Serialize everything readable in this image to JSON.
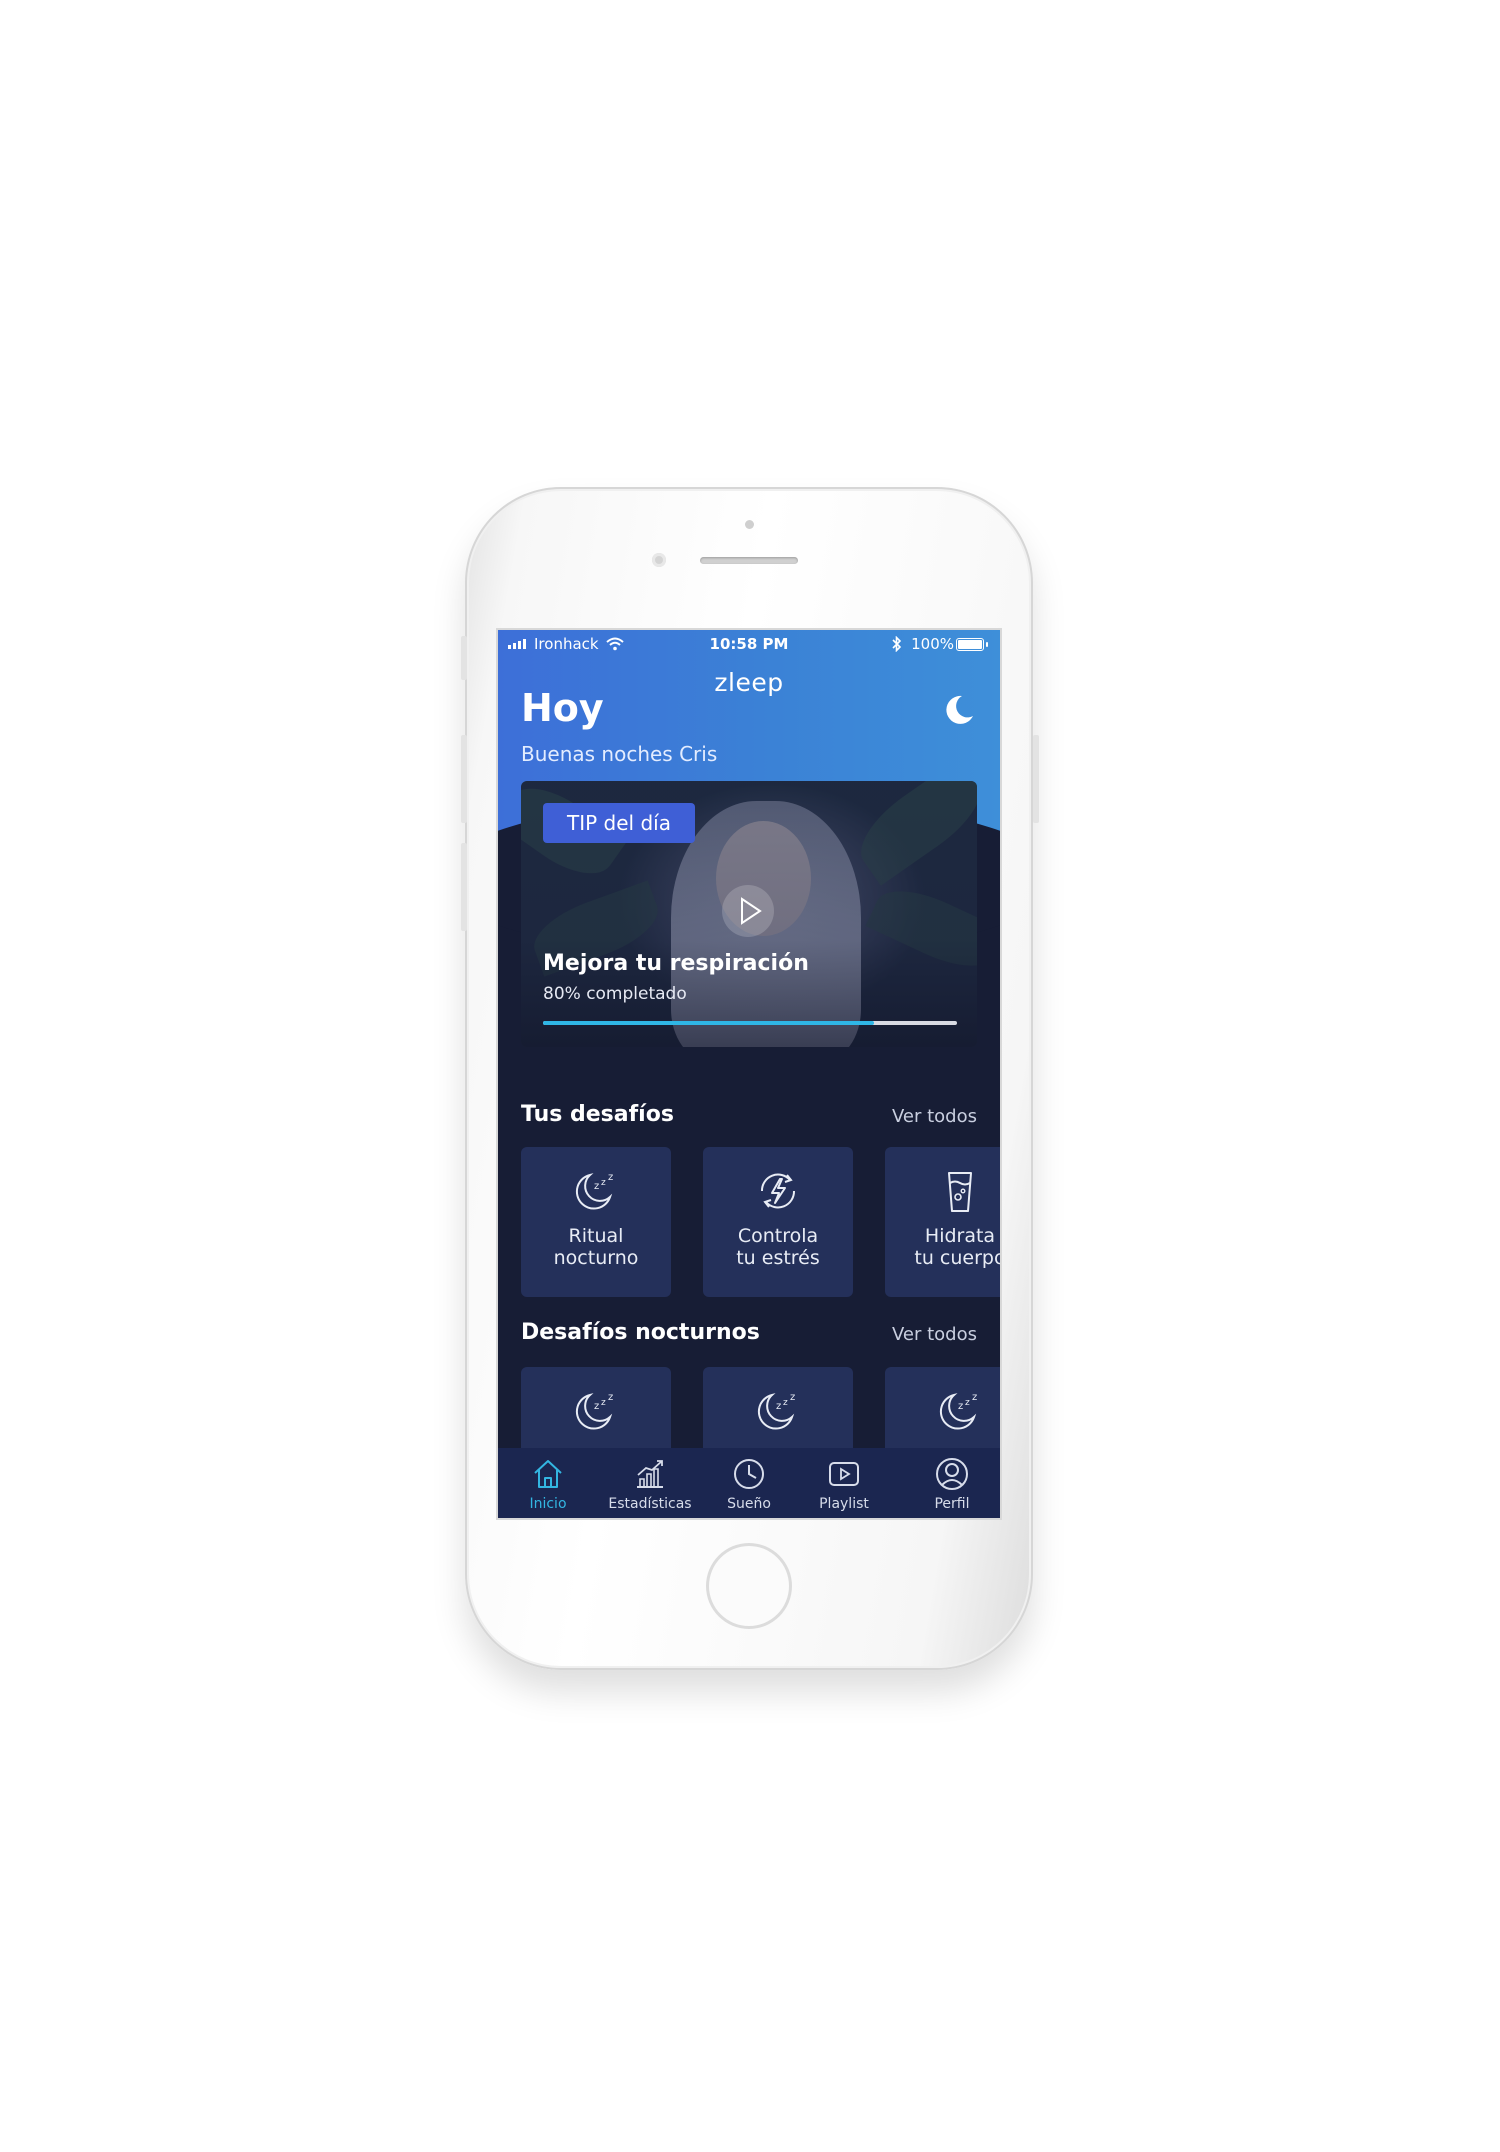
{
  "status_bar": {
    "carrier": "Ironhack",
    "time": "10:58 PM",
    "battery": "100%"
  },
  "header": {
    "logo": "zleep",
    "title": "Hoy",
    "greeting": "Buenas noches Cris"
  },
  "tip": {
    "badge": "TIP del día",
    "title": "Mejora tu respiración",
    "progress_label": "80% completado",
    "progress": 0.8
  },
  "challenges": {
    "title": "Tus desafíos",
    "see_all": "Ver todos",
    "items": [
      {
        "line1": "Ritual",
        "line2": "nocturno",
        "icon": "moon-zzz-icon"
      },
      {
        "line1": "Controla",
        "line2": "tu estrés",
        "icon": "stress-bolt-icon"
      },
      {
        "line1": "Hidrata",
        "line2": "tu cuerpo",
        "icon": "water-glass-icon"
      }
    ]
  },
  "night_challenges": {
    "title": "Desafíos nocturnos",
    "see_all": "Ver todos",
    "items": [
      {
        "icon": "moon-zzz-icon"
      },
      {
        "icon": "moon-zzz-icon"
      },
      {
        "icon": "moon-zzz-icon"
      }
    ]
  },
  "tabbar": {
    "active": "inicio",
    "items": [
      {
        "id": "inicio",
        "label": "Inicio",
        "icon": "home-icon"
      },
      {
        "id": "estadisticas",
        "label": "Estadísticas",
        "icon": "stats-icon"
      },
      {
        "id": "sueno",
        "label": "Sueño",
        "icon": "clock-icon"
      },
      {
        "id": "playlist",
        "label": "Playlist",
        "icon": "play-square-icon"
      },
      {
        "id": "perfil",
        "label": "Perfil",
        "icon": "profile-icon"
      }
    ]
  },
  "colors": {
    "accent": "#33b6e2",
    "header_blue": "#3b82d6",
    "background": "#171d35",
    "card": "#24305a",
    "badge": "#3f5fd6"
  }
}
